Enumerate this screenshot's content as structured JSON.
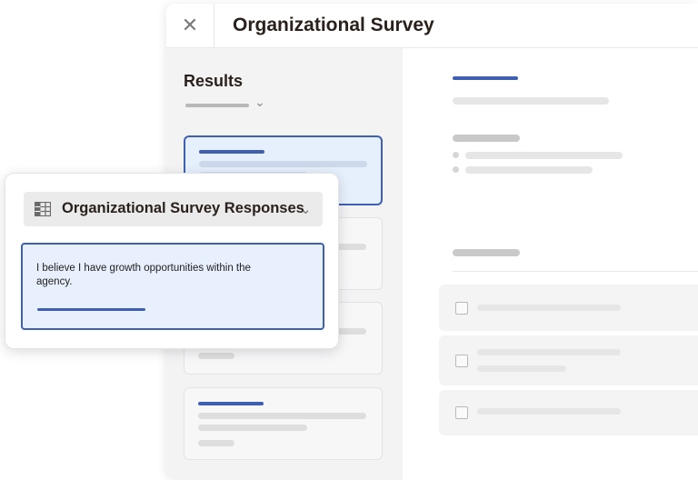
{
  "window": {
    "title": "Organizational Survey",
    "close_glyph": "✕"
  },
  "sidebar": {
    "title": "Results",
    "sort_chevron": "⌄"
  },
  "popup": {
    "selector_label": "Organizational Survey Responses",
    "selector_icon": "table-icon",
    "selector_chevron": "⌄",
    "response_text": "I believe I have growth opportunities within the agency."
  },
  "colors": {
    "accent": "#3f5fb3",
    "selected_bg": "#e6f0fc",
    "title_text": "#2a211c"
  }
}
